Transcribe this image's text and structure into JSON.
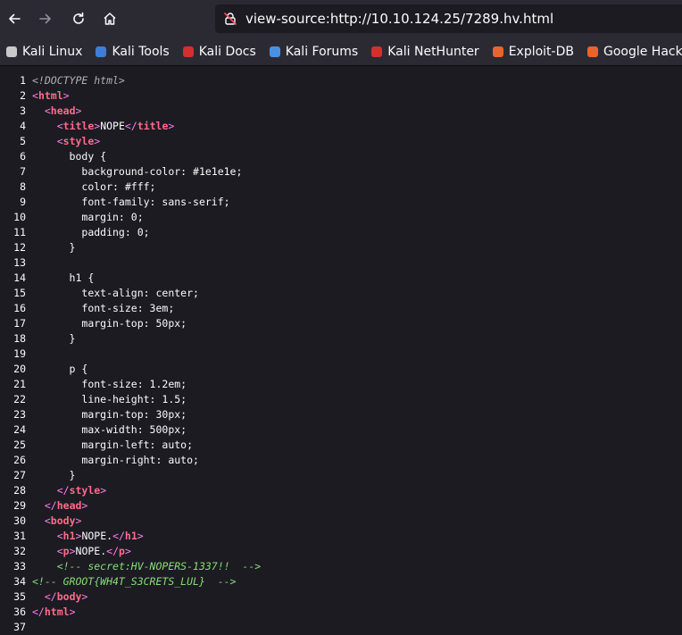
{
  "toolbar": {
    "url": "view-source:http://10.10.124.25/7289.hv.html",
    "back_icon": "arrow-left-icon",
    "forward_icon": "arrow-right-icon",
    "reload_icon": "reload-icon",
    "home_icon": "home-icon"
  },
  "bookmarks": [
    {
      "label": "Kali Linux",
      "icon": "kali-dragon-icon",
      "color": "#c9c9c9"
    },
    {
      "label": "Kali Tools",
      "icon": "kali-tools-icon",
      "color": "#3d7fd6"
    },
    {
      "label": "Kali Docs",
      "icon": "kali-docs-icon",
      "color": "#d32f2f"
    },
    {
      "label": "Kali Forums",
      "icon": "kali-forums-icon",
      "color": "#4a90e2"
    },
    {
      "label": "Kali NetHunter",
      "icon": "kali-nethunter-icon",
      "color": "#d32f2f"
    },
    {
      "label": "Exploit-DB",
      "icon": "exploit-db-icon",
      "color": "#e8642c"
    },
    {
      "label": "Google Hacking D",
      "icon": "ghdb-icon",
      "color": "#e8642c"
    }
  ],
  "source_lines": [
    {
      "n": "1",
      "indent": "",
      "kind": "doctype",
      "text": "<!DOCTYPE html>"
    },
    {
      "n": "2",
      "indent": "",
      "kind": "open",
      "tag": "html"
    },
    {
      "n": "3",
      "indent": "  ",
      "kind": "open",
      "tag": "head"
    },
    {
      "n": "4",
      "indent": "    ",
      "kind": "inline",
      "tag": "title",
      "text": "NOPE"
    },
    {
      "n": "5",
      "indent": "    ",
      "kind": "open",
      "tag": "style"
    },
    {
      "n": "6",
      "indent": "      ",
      "kind": "text",
      "text": "body {"
    },
    {
      "n": "7",
      "indent": "        ",
      "kind": "text",
      "text": "background-color: #1e1e1e;"
    },
    {
      "n": "8",
      "indent": "        ",
      "kind": "text",
      "text": "color: #fff;"
    },
    {
      "n": "9",
      "indent": "        ",
      "kind": "text",
      "text": "font-family: sans-serif;"
    },
    {
      "n": "10",
      "indent": "        ",
      "kind": "text",
      "text": "margin: 0;"
    },
    {
      "n": "11",
      "indent": "        ",
      "kind": "text",
      "text": "padding: 0;"
    },
    {
      "n": "12",
      "indent": "      ",
      "kind": "text",
      "text": "}"
    },
    {
      "n": "13",
      "indent": "",
      "kind": "text",
      "text": ""
    },
    {
      "n": "14",
      "indent": "      ",
      "kind": "text",
      "text": "h1 {"
    },
    {
      "n": "15",
      "indent": "        ",
      "kind": "text",
      "text": "text-align: center;"
    },
    {
      "n": "16",
      "indent": "        ",
      "kind": "text",
      "text": "font-size: 3em;"
    },
    {
      "n": "17",
      "indent": "        ",
      "kind": "text",
      "text": "margin-top: 50px;"
    },
    {
      "n": "18",
      "indent": "      ",
      "kind": "text",
      "text": "}"
    },
    {
      "n": "19",
      "indent": "",
      "kind": "text",
      "text": ""
    },
    {
      "n": "20",
      "indent": "      ",
      "kind": "text",
      "text": "p {"
    },
    {
      "n": "21",
      "indent": "        ",
      "kind": "text",
      "text": "font-size: 1.2em;"
    },
    {
      "n": "22",
      "indent": "        ",
      "kind": "text",
      "text": "line-height: 1.5;"
    },
    {
      "n": "23",
      "indent": "        ",
      "kind": "text",
      "text": "margin-top: 30px;"
    },
    {
      "n": "24",
      "indent": "        ",
      "kind": "text",
      "text": "max-width: 500px;"
    },
    {
      "n": "25",
      "indent": "        ",
      "kind": "text",
      "text": "margin-left: auto;"
    },
    {
      "n": "26",
      "indent": "        ",
      "kind": "text",
      "text": "margin-right: auto;"
    },
    {
      "n": "27",
      "indent": "      ",
      "kind": "text",
      "text": "}"
    },
    {
      "n": "28",
      "indent": "    ",
      "kind": "close",
      "tag": "style"
    },
    {
      "n": "29",
      "indent": "  ",
      "kind": "close",
      "tag": "head"
    },
    {
      "n": "30",
      "indent": "  ",
      "kind": "open",
      "tag": "body"
    },
    {
      "n": "31",
      "indent": "    ",
      "kind": "inline",
      "tag": "h1",
      "text": "NOPE."
    },
    {
      "n": "32",
      "indent": "    ",
      "kind": "inline",
      "tag": "p",
      "text": "NOPE."
    },
    {
      "n": "33",
      "indent": "    ",
      "kind": "comment",
      "text": "<!-- secret:HV-NOPERS-1337!!  -->"
    },
    {
      "n": "34",
      "indent": "",
      "kind": "comment",
      "text": "<!-- GROOT{WH4T_S3CRETS_LUL}  -->"
    },
    {
      "n": "35",
      "indent": "  ",
      "kind": "close",
      "tag": "body"
    },
    {
      "n": "36",
      "indent": "",
      "kind": "close",
      "tag": "html"
    },
    {
      "n": "37",
      "indent": "",
      "kind": "text",
      "text": ""
    }
  ]
}
